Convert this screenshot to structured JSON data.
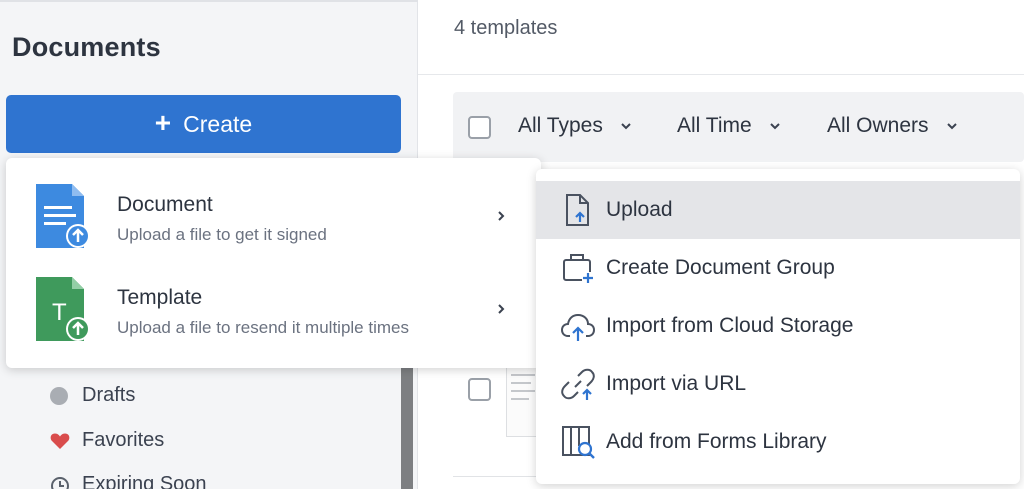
{
  "sidebar": {
    "title": "Documents",
    "create_label": "Create",
    "folders": [
      {
        "label": "Drafts",
        "icon": "dot-icon"
      },
      {
        "label": "Favorites",
        "icon": "heart-icon"
      },
      {
        "label": "Expiring Soon",
        "icon": "clock-icon"
      }
    ]
  },
  "main": {
    "count_text": "4 templates",
    "filters": [
      {
        "label": "All Types"
      },
      {
        "label": "All Time"
      },
      {
        "label": "All Owners"
      }
    ]
  },
  "create_menu": {
    "items": [
      {
        "title": "Document",
        "desc": "Upload a file to get it signed",
        "icon": "document-upload-icon",
        "icon_letter": ""
      },
      {
        "title": "Template",
        "desc": "Upload a file to resend it multiple times",
        "icon": "template-upload-icon",
        "icon_letter": "T"
      }
    ]
  },
  "submenu": {
    "items": [
      {
        "label": "Upload",
        "icon": "file-upload-icon"
      },
      {
        "label": "Create Document Group",
        "icon": "document-group-icon"
      },
      {
        "label": "Import from Cloud Storage",
        "icon": "cloud-upload-icon"
      },
      {
        "label": "Import via URL",
        "icon": "link-icon"
      },
      {
        "label": "Add from Forms Library",
        "icon": "forms-library-icon"
      }
    ]
  },
  "colors": {
    "primary": "#2f74d0",
    "doc_icon_blue": "#3d8ae0",
    "template_icon_green": "#3f9a5c",
    "heart_red": "#d94c4c",
    "submenu_active": "#e4e5e8"
  }
}
